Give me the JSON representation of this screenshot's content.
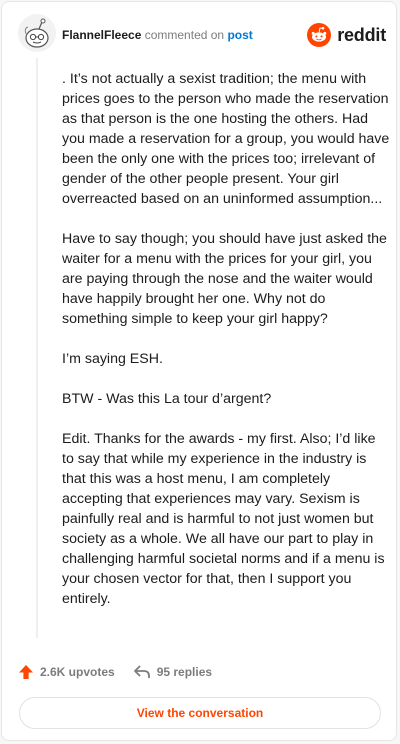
{
  "comment": {
    "username": "FlannelFleece",
    "action_text": "commented on",
    "post_label": "post",
    "paragraphs": [
      ". It’s not actually a sexist tradition; the menu with prices goes to the person who made the reservation as that person is the one hosting the others. Had you made a reservation for a group, you would have been the only one with the prices too; irrelevant of gender of the other people present. Your girl overreacted based on an uninformed assumption...",
      "Have to say though; you should have just asked the waiter for a menu with the prices for your girl, you are paying through the nose and the waiter would have happily brought her one. Why not do something simple to keep your girl happy?",
      "I’m saying ESH.",
      "BTW - Was this La tour d’argent?",
      "Edit. Thanks for the awards - my first. Also; I’d like to say that while my experience in the industry is that this was a host menu, I am completely accepting that experiences may vary. Sexism is painfully real and is harmful to not just women but society as a whole. We all have our part to play in challenging harmful societal norms and if a menu is your chosen vector for that, then I support you entirely."
    ]
  },
  "brand": {
    "name": "reddit",
    "icon": "reddit-snoo-icon",
    "color": "#ff4500"
  },
  "stats": {
    "upvotes": "2.6K upvotes",
    "replies": "95 replies"
  },
  "cta": {
    "label": "View the conversation"
  },
  "colors": {
    "accent": "#ff4500",
    "link": "#0079d3",
    "muted": "#7c7c7c"
  }
}
